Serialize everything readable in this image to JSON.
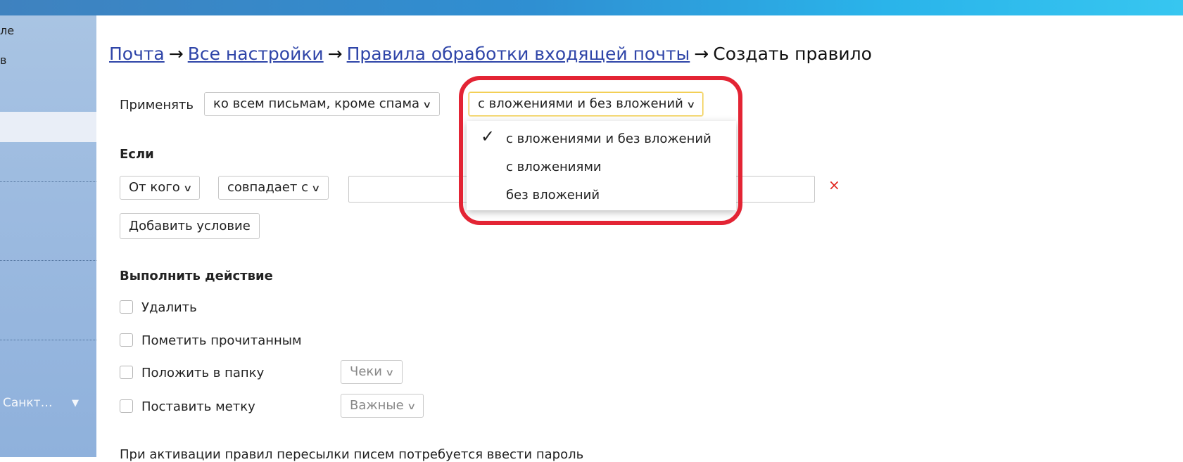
{
  "sidebar": {
    "item1": "ле",
    "item2": "в",
    "city": "Санкт…",
    "city_arrow": "▼"
  },
  "breadcrumb": {
    "mail": "Почта",
    "all_settings": "Все настройки",
    "rules": "Правила обработки входящей почты",
    "current": "Создать правило",
    "separator": "→"
  },
  "apply": {
    "label": "Применять",
    "scope_value": "ко всем письмам, кроме спама",
    "attachments_value": "с вложениями и без вложений"
  },
  "dropdown": {
    "options": [
      "с вложениями и без вложений",
      "с вложениями",
      "без вложений"
    ],
    "selected_index": 0
  },
  "condition": {
    "heading": "Если",
    "field": "От кого",
    "operator": "совпадает с",
    "value": "",
    "add_button": "Добавить условие",
    "delete_icon": "×"
  },
  "actions": {
    "heading": "Выполнить действие",
    "items": [
      {
        "label": "Удалить",
        "checked": false
      },
      {
        "label": "Пометить прочитанным",
        "checked": false
      },
      {
        "label": "Положить в папку",
        "checked": false,
        "select": "Чеки"
      },
      {
        "label": "Поставить метку",
        "checked": false,
        "select": "Важные"
      }
    ]
  },
  "footer_note": "При активации правил пересылки писем потребуется ввести пароль",
  "colors": {
    "link": "#2f45a8",
    "highlight": "#e32434",
    "delete": "#e0241c",
    "active_border": "#f2cd4e"
  }
}
